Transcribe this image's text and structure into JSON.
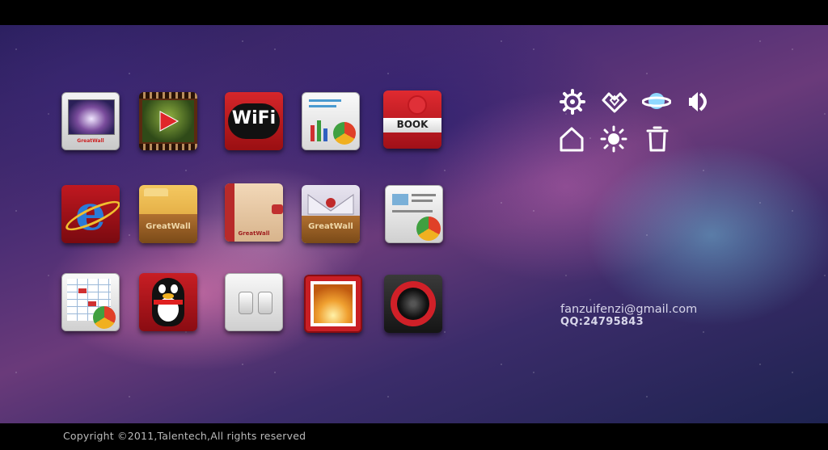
{
  "footer": {
    "copyright": "Copyright ©2011,Talentech,All rights reserved"
  },
  "contact": {
    "email": "fanzuifenzi@gmail.com",
    "qq": "QQ:24795843"
  },
  "app_icons": [
    {
      "name": "photo-frame-icon",
      "label": "GreatWall"
    },
    {
      "name": "video-player-icon",
      "label": ""
    },
    {
      "name": "wifi-icon",
      "label": "WiFi"
    },
    {
      "name": "chart-document-icon",
      "label": ""
    },
    {
      "name": "book-icon",
      "label": "BOOK"
    },
    {
      "name": "internet-explorer-icon",
      "label": ""
    },
    {
      "name": "folder-icon",
      "label": "GreatWall"
    },
    {
      "name": "leather-notebook-icon",
      "label": "GreatWall"
    },
    {
      "name": "mail-inbox-icon",
      "label": "GreatWall"
    },
    {
      "name": "news-document-icon",
      "label": ""
    },
    {
      "name": "spreadsheet-icon",
      "label": ""
    },
    {
      "name": "qq-penguin-icon",
      "label": ""
    },
    {
      "name": "light-switch-icon",
      "label": ""
    },
    {
      "name": "photo-album-icon",
      "label": ""
    },
    {
      "name": "speaker-icon",
      "label": ""
    }
  ],
  "system_icons": [
    "gear-icon",
    "diamond-icon",
    "planet-icon",
    "sound-icon",
    "home-icon",
    "brightness-icon",
    "trash-icon"
  ],
  "colors": {
    "accent_glyph": "#ffffff",
    "planet_accent": "#8fd8ff",
    "background_top": "#2a1f5e"
  }
}
